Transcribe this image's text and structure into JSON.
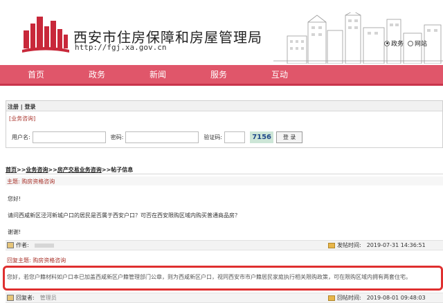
{
  "site": {
    "title": "西安市住房保障和房屋管理局",
    "url": "http://fgj.xa.gov.cn"
  },
  "search_scope": {
    "options": [
      "政务",
      "网站"
    ],
    "selected": "政务"
  },
  "nav": [
    "首页",
    "政务",
    "新闻",
    "服务",
    "互动"
  ],
  "login": {
    "header": "注册 | 登录",
    "section": "[业务咨询]",
    "username_label": "用户名:",
    "password_label": "密码:",
    "captcha_label": "验证码:",
    "captcha_code": "7156",
    "submit_label": "登 录"
  },
  "breadcrumb": {
    "items": [
      "首页",
      "业务咨询",
      "房产交易业务咨询",
      "帖子信息"
    ],
    "separator": ">>"
  },
  "post": {
    "subject_label": "主题:",
    "subject": "购房资格咨询",
    "greeting": "您好!",
    "question": "请问西咸新区泾河新城户口的居民是否属于西安户口？可否在西安限购区域内购买普通商品房？",
    "thanks": "谢谢!",
    "author_label": "作者:",
    "time_label": "发帖时间:",
    "time": "2019-07-31 14:36:51"
  },
  "reply": {
    "subject_label": "回复主题:",
    "subject": "购房资格咨询",
    "text": "您好，若您户籍材料如户口本已加盖西咸新区户籍管理部门公章，则为西咸新区户口，视同西安市市户籍居民家庭执行相关限购政策，可在限购区域内拥有两套住宅。",
    "replier_label": "回复者:",
    "replier": "管理员",
    "time_label": "回帖时间:",
    "time": "2019-08-01 09:48:03"
  },
  "colors": {
    "nav_bg": "#e0566a",
    "logo_red": "#c8283a",
    "highlight": "#df2f2f"
  }
}
